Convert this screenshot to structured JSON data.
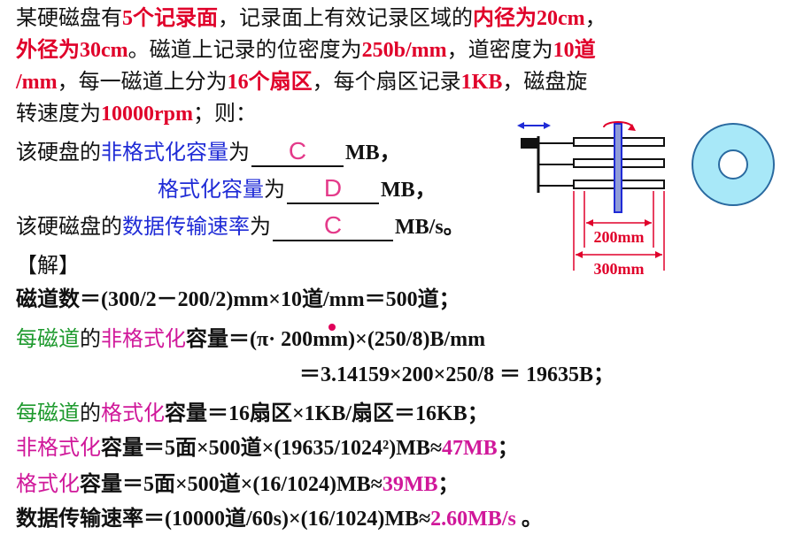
{
  "problem": {
    "l1": {
      "a": "某硬磁盘有",
      "b": "5个记录面",
      "c": "，记录面上有效记录区域的",
      "d": "内径为20cm",
      "e": "，"
    },
    "l2": {
      "a": "外径为30cm",
      "b": "。磁道上记录的位密度为",
      "c": "250b/mm",
      "d": "，道密度为",
      "e": "10道"
    },
    "l3": {
      "a": "/mm",
      "b": "，每一磁道上分为",
      "c": "16个扇区",
      "d": "，每个扇区记录",
      "e": "1KB",
      "f": "，磁盘旋"
    },
    "l4": {
      "a": "转速度为",
      "b": "10000rpm",
      "c": "；则："
    },
    "l5": {
      "a": "该硬盘的",
      "b": "非格式化容量",
      "c": "为",
      "ans": "C",
      "d": "MB，"
    },
    "l6": {
      "b": "格式化容量",
      "c": "为",
      "ans": "D",
      "d": "MB，"
    },
    "l7": {
      "a": "该硬磁盘的",
      "b": "数据传输速率",
      "c": "为",
      "ans": "C",
      "d": "MB/s。"
    }
  },
  "solution": {
    "header": "【解】",
    "s1": {
      "a": "磁道数＝(300/2－200/2)mm×10道/mm＝500道；"
    },
    "s2": {
      "a": "每磁道",
      "b": "的",
      "c": "非格式化",
      "d": "容量＝(",
      "e": "π",
      "f": "· 200mm)×(250/8)B/mm"
    },
    "s3": {
      "a": "＝3.14159×200×250/8 ＝ 19635B；"
    },
    "s4": {
      "a": "每磁道",
      "b": "的",
      "c": "格式化",
      "d": "容量＝16扇区×1KB/扇区＝16KB；"
    },
    "s5": {
      "a": "非格式化",
      "b": "容量＝5面×500道×(19635/1024²)MB≈",
      "c": "47MB",
      "d": "；"
    },
    "s6": {
      "a": "格式化",
      "b": "容量＝5面×500道×(16/1024)MB≈",
      "c": "39MB",
      "d": "；"
    },
    "s7": {
      "a": "数据传输速率＝(10000道/60s)×(16/1024)MB≈",
      "c": "2.60MB/s",
      "d": " 。"
    }
  },
  "diagram": {
    "inner_label": "200mm",
    "outer_label": "300mm"
  },
  "colors": {
    "red": "#e0002a",
    "blue": "#1f2bd6",
    "green": "#1e9a2e",
    "magenta": "#d0189a",
    "answer": "#e43a8a",
    "platter_fill": "#a8e8f8",
    "platter_stroke": "#2a6aa0"
  }
}
